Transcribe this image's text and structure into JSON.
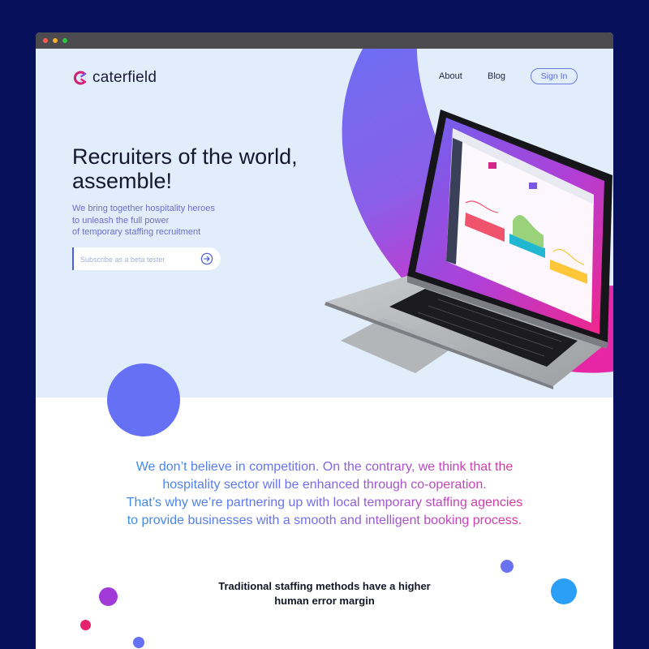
{
  "brand": {
    "name": "caterfield"
  },
  "nav": {
    "about": "About",
    "blog": "Blog",
    "sign_in": "Sign In"
  },
  "hero": {
    "headline_line1": "Recruiters of the world,",
    "headline_line2": "assemble!",
    "sub_line1": "We bring together hospitality heroes",
    "sub_line2": "to unleash the full power",
    "sub_line3": "of temporary staffing recruitment",
    "subscribe_placeholder": "Subscribe as a beta tester"
  },
  "mission": {
    "line1": "We don’t believe in competition. On the contrary, we think that the",
    "line2": "hospitality sector will be enhanced through co-operation.",
    "line3": "That’s why we’re partnering up with local temporary staffing agencies",
    "line4": "to provide businesses with a smooth and intelligent booking process."
  },
  "section": {
    "heading_line1": "Traditional staffing methods have a higher",
    "heading_line2": "human error margin"
  },
  "colors": {
    "page_background": "#07105a",
    "hero_background": "#e1edfb",
    "accent_blue": "#6570f5",
    "accent_magenta": "#e0228a",
    "accent_purple": "#9d3ee0",
    "accent_cyan": "#2a9ff5"
  },
  "icons": [
    "logo-mark-icon",
    "arrow-right-circle-icon",
    "laptop-illustration",
    "window-dot-icon"
  ]
}
